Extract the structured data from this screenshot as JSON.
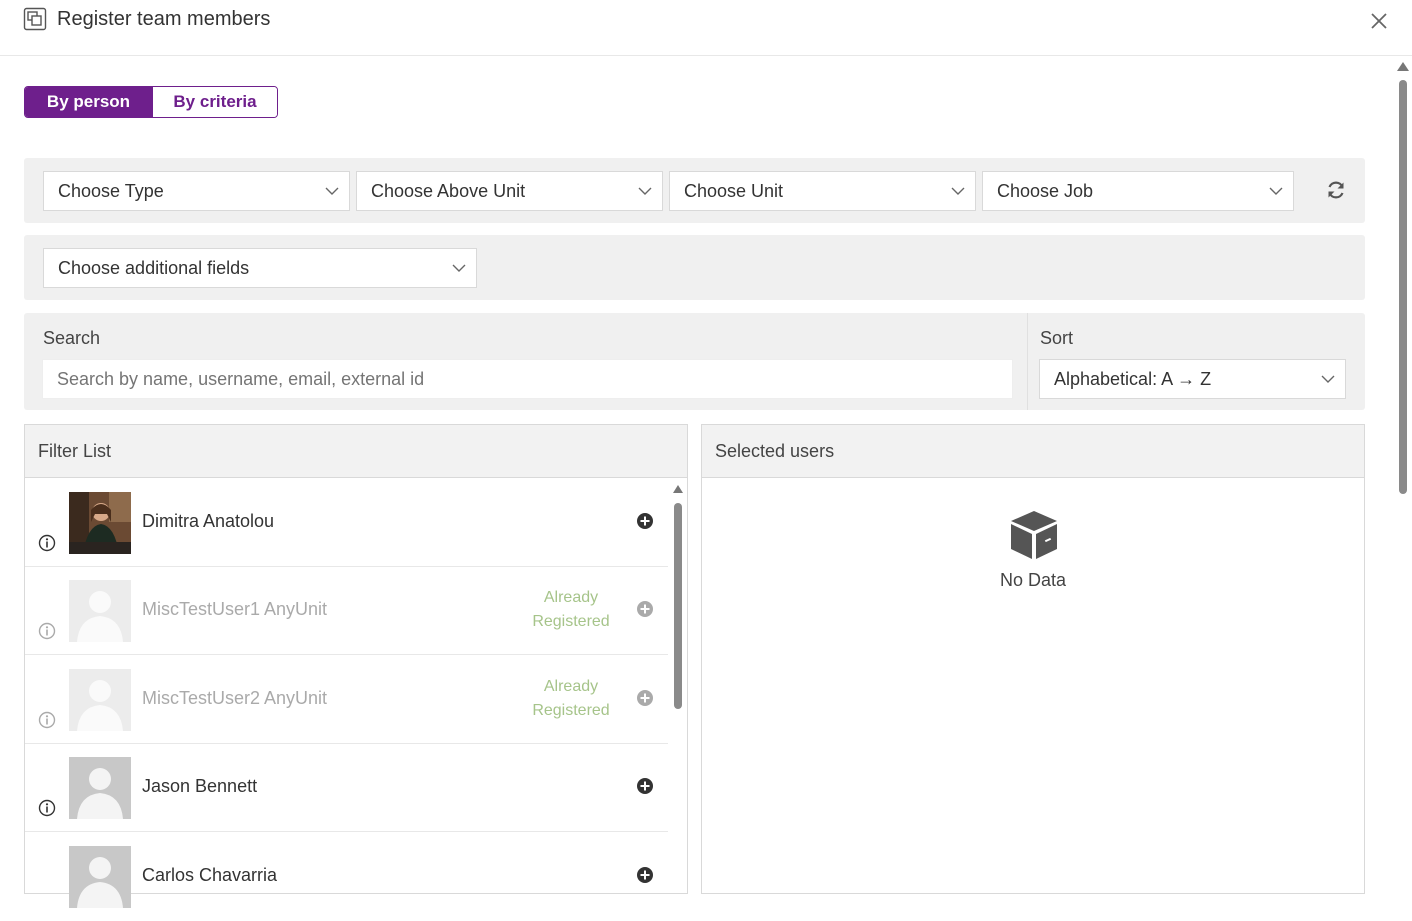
{
  "dialog": {
    "title": "Register team members",
    "close_icon": "close-icon",
    "window_icon": "windows-icon"
  },
  "tabs": [
    {
      "label": "By person",
      "active": true
    },
    {
      "label": "By criteria",
      "active": false
    }
  ],
  "filters": {
    "type": "Choose Type",
    "above_unit": "Choose Above Unit",
    "unit": "Choose Unit",
    "job": "Choose Job",
    "refresh_icon": "refresh-icon",
    "additional_fields": "Choose additional fields"
  },
  "search": {
    "label": "Search",
    "placeholder": "Search by name, username, email, external id",
    "value": ""
  },
  "sort": {
    "label": "Sort",
    "value": "Alphabetical: A → Z"
  },
  "filter_list": {
    "title": "Filter List",
    "items": [
      {
        "name": "Dimitra Anatolou",
        "status": "",
        "photo": true,
        "dim": false
      },
      {
        "name": "MiscTestUser1 AnyUnit",
        "status_line1": "Already",
        "status_line2": "Registered",
        "photo": false,
        "dim": true
      },
      {
        "name": "MiscTestUser2 AnyUnit",
        "status_line1": "Already",
        "status_line2": "Registered",
        "photo": false,
        "dim": true
      },
      {
        "name": "Jason Bennett",
        "status": "",
        "photo": false,
        "dim": false
      },
      {
        "name": "Carlos Chavarria",
        "status": "",
        "photo": false,
        "dim": false
      }
    ]
  },
  "selected_users": {
    "title": "Selected users",
    "empty_text": "No Data",
    "empty_icon": "empty-box-icon"
  },
  "colors": {
    "accent": "#6e1f8c",
    "registered_text": "#a6c48a",
    "panel_bg": "#f0f0f0"
  }
}
